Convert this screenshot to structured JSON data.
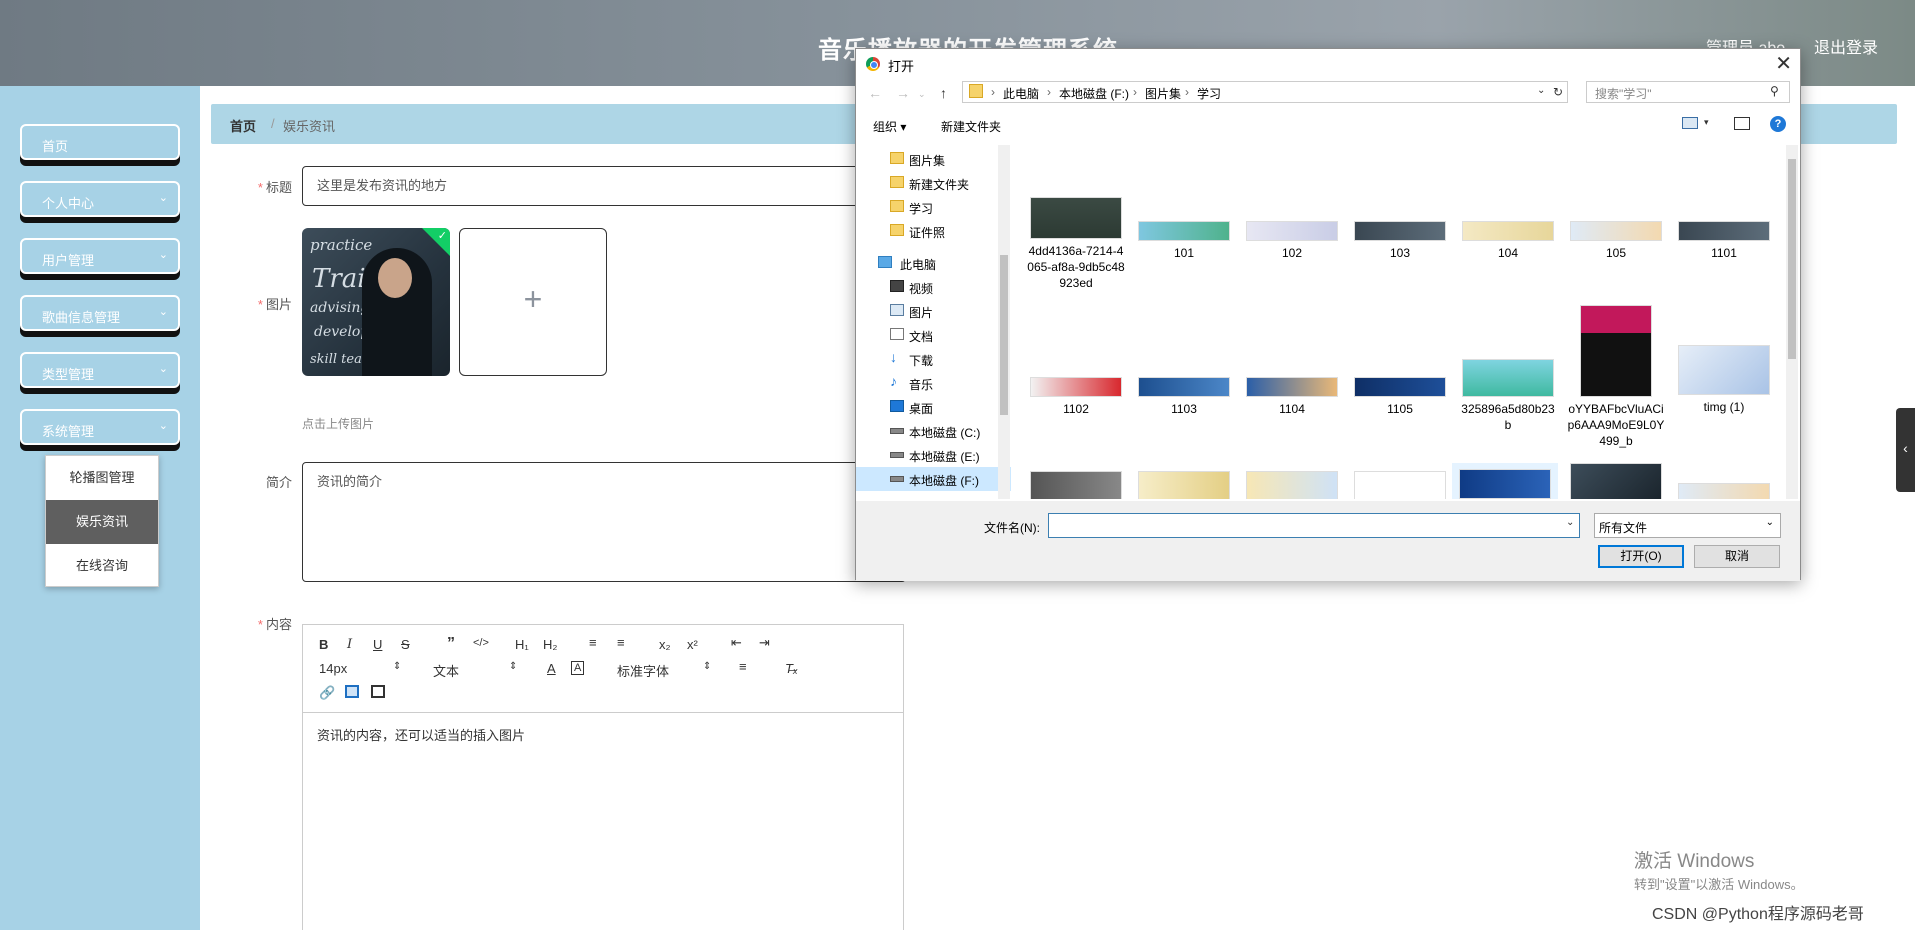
{
  "header": {
    "title": "音乐播放器的开发管理系统",
    "user": "管理员 abo",
    "logout": "退出登录"
  },
  "sidebar": {
    "items": [
      {
        "label": "首页",
        "has_children": false
      },
      {
        "label": "个人中心",
        "has_children": true
      },
      {
        "label": "用户管理",
        "has_children": true
      },
      {
        "label": "歌曲信息管理",
        "has_children": true
      },
      {
        "label": "类型管理",
        "has_children": true
      },
      {
        "label": "系统管理",
        "has_children": true
      }
    ],
    "submenu": [
      "轮播图管理",
      "娱乐资讯",
      "在线咨询"
    ],
    "submenu_active": "娱乐资讯"
  },
  "breadcrumb": {
    "home": "首页",
    "separator": "/",
    "current": "娱乐资讯"
  },
  "form": {
    "title_label": "标题",
    "title_value": "这里是发布资讯的地方",
    "image_label": "图片",
    "upload_hint": "点击上传图片",
    "intro_label": "简介",
    "intro_placeholder": "资讯的简介",
    "content_label": "内容",
    "editor": {
      "font_size": "14px",
      "paragraph": "文本",
      "font_family": "标准字体",
      "content": "资讯的内容，还可以适当的插入图片"
    }
  },
  "dialog": {
    "title": "打开",
    "address": [
      "此电脑",
      "本地磁盘 (F:)",
      "图片集",
      "学习"
    ],
    "search_placeholder": "搜索\"学习\"",
    "organize": "组织",
    "new_folder": "新建文件夹",
    "tree": [
      {
        "label": "图片集",
        "icon": "folder-icon"
      },
      {
        "label": "新建文件夹",
        "icon": "folder-icon"
      },
      {
        "label": "学习",
        "icon": "folder-icon"
      },
      {
        "label": "证件照",
        "icon": "folder-icon"
      },
      {
        "label": "此电脑",
        "icon": "computer-icon"
      },
      {
        "label": "视频",
        "icon": "video-icon"
      },
      {
        "label": "图片",
        "icon": "pictures-icon"
      },
      {
        "label": "文档",
        "icon": "document-icon"
      },
      {
        "label": "下载",
        "icon": "download-icon"
      },
      {
        "label": "音乐",
        "icon": "music-icon"
      },
      {
        "label": "桌面",
        "icon": "desktop-icon"
      },
      {
        "label": "本地磁盘 (C:)",
        "icon": "drive-icon"
      },
      {
        "label": "本地磁盘 (E:)",
        "icon": "drive-icon"
      },
      {
        "label": "本地磁盘 (F:)",
        "icon": "drive-icon"
      }
    ],
    "files_row1": [
      "4dd4136a-7214-4065-af8a-9db5c48923ed",
      "101",
      "102",
      "103",
      "104",
      "105",
      "1101"
    ],
    "files_row2": [
      "1102",
      "1103",
      "1104",
      "1105",
      "325896a5d80b23b",
      "oYYBAFbcVluACip6AAA9MoE9L0Y499_b",
      "timg (1)"
    ],
    "filename_label": "文件名(N):",
    "filename_value": "",
    "filetype": "所有文件",
    "open": "打开(O)",
    "cancel": "取消"
  },
  "watermark": {
    "line1": "激活 Windows",
    "line2": "转到\"设置\"以激活 Windows。",
    "csdn": "CSDN @Python程序源码老哥"
  },
  "colors": {
    "sidebar": "#a7d2e6",
    "breadcrumb": "#aed6e6",
    "accent": "#0078d7",
    "required": "#f56c6c"
  }
}
